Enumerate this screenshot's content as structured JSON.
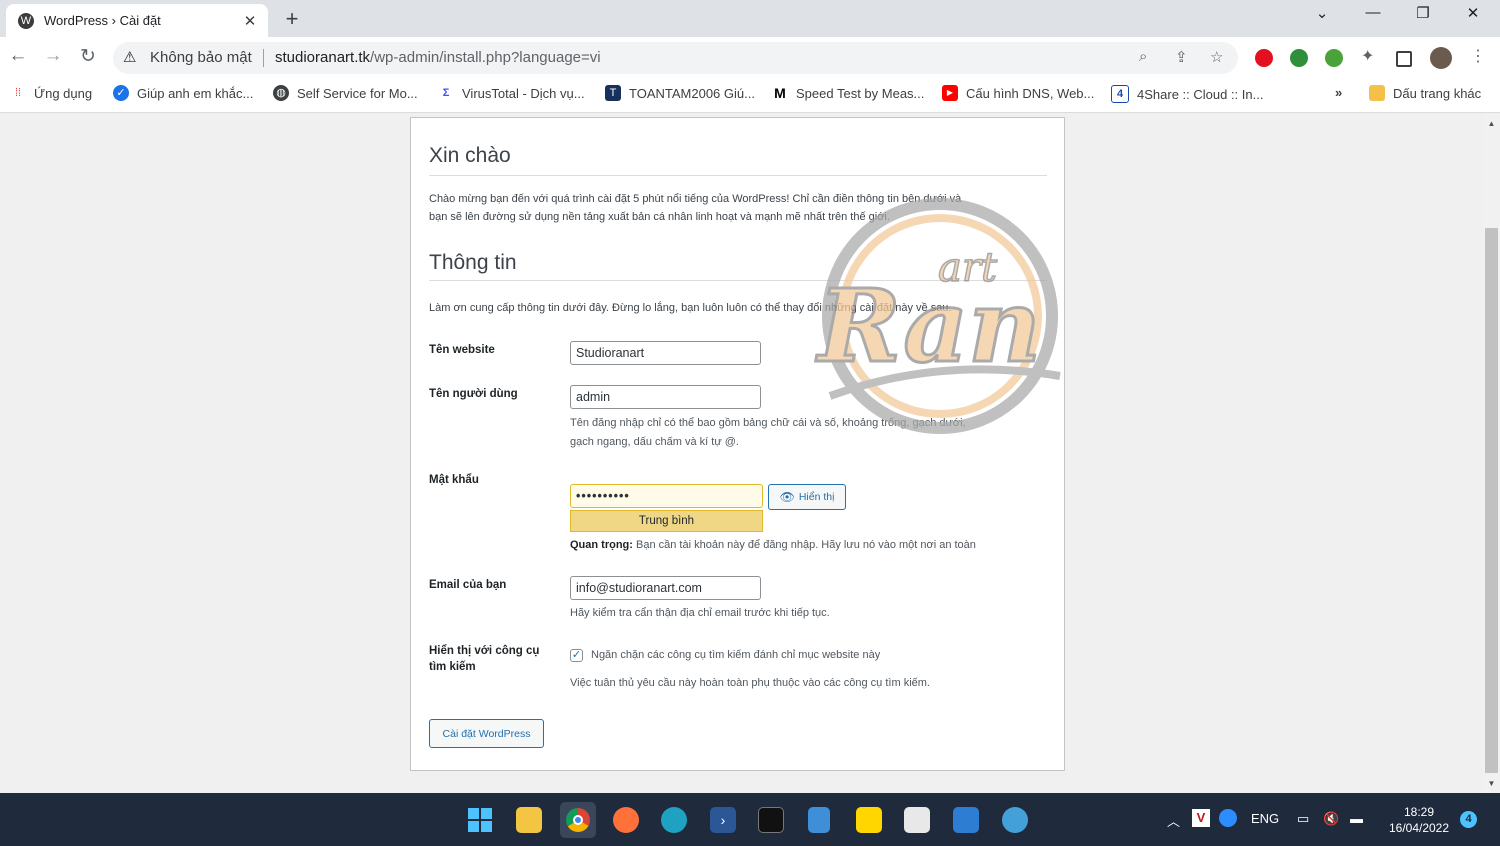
{
  "browser": {
    "tab_title": "WordPress › Cài đặt",
    "tab_close": "✕",
    "new_tab": "+",
    "security_label": "Không bảo mật",
    "url_host": "studioranart.tk",
    "url_path": "/wp-admin/install.php?language=vi",
    "bookmarks": [
      "Ứng dụng",
      "Giúp anh em khắc...",
      "Self Service for Mo...",
      "VirusTotal - Dịch vụ...",
      "TOANTAM2006 Giú...",
      "Speed Test by Meas...",
      "Cấu hình DNS, Web...",
      "4Share :: Cloud :: In..."
    ],
    "bookmarks_more": "»",
    "other_bookmarks": "Dấu trang khác"
  },
  "page": {
    "welcome_heading": "Xin chào",
    "welcome_text_1": "Chào mừng bạn đến với quá trình cài đặt 5 phút nổi tiếng của WordPress! Chỉ cần điền thông tin bên dưới và",
    "welcome_text_2": "bạn sẽ lên đường sử dụng nền tảng xuất bản cá nhân linh hoạt và mạnh mẽ nhất trên thế giới.",
    "info_heading": "Thông tin",
    "info_text": "Làm ơn cung cấp thông tin dưới đây. Đừng lo lắng, bạn luôn luôn có thể thay đổi những cài đặt này về sau.",
    "site_title_label": "Tên website",
    "site_title_value": "Studioranart",
    "username_label": "Tên người dùng",
    "username_value": "admin",
    "username_hint_1": "Tên đăng nhập chỉ có thể bao gồm bảng chữ cái và số, khoảng trống, gạch dưới,",
    "username_hint_2": "gạch ngang, dấu chấm và kí tự @.",
    "password_label": "Mật khẩu",
    "password_value": "••••••••••",
    "show_button": "Hiển thị",
    "strength": "Trung bình",
    "important_bold": "Quan trọng:",
    "important_text": " Bạn cần tài khoản này để đăng nhập. Hãy lưu nó vào một nơi an toàn",
    "email_label": "Email của bạn",
    "email_value": "info@studioranart.com",
    "email_hint": "Hãy kiểm tra cẩn thận địa chỉ email trước khi tiếp tục.",
    "search_label": "Hiển thị với công cụ tìm kiếm",
    "search_checkbox_label": "Ngăn chặn các công cụ tìm kiếm đánh chỉ mục website này",
    "search_hint": "Việc tuân thủ yêu cầu này hoàn toàn phụ thuộc vào các công cụ tìm kiếm.",
    "install_button": "Cài đặt WordPress",
    "watermark_text": "art Ran"
  },
  "taskbar": {
    "language": "ENG",
    "time": "18:29",
    "date": "16/04/2022",
    "notifications": "4"
  }
}
